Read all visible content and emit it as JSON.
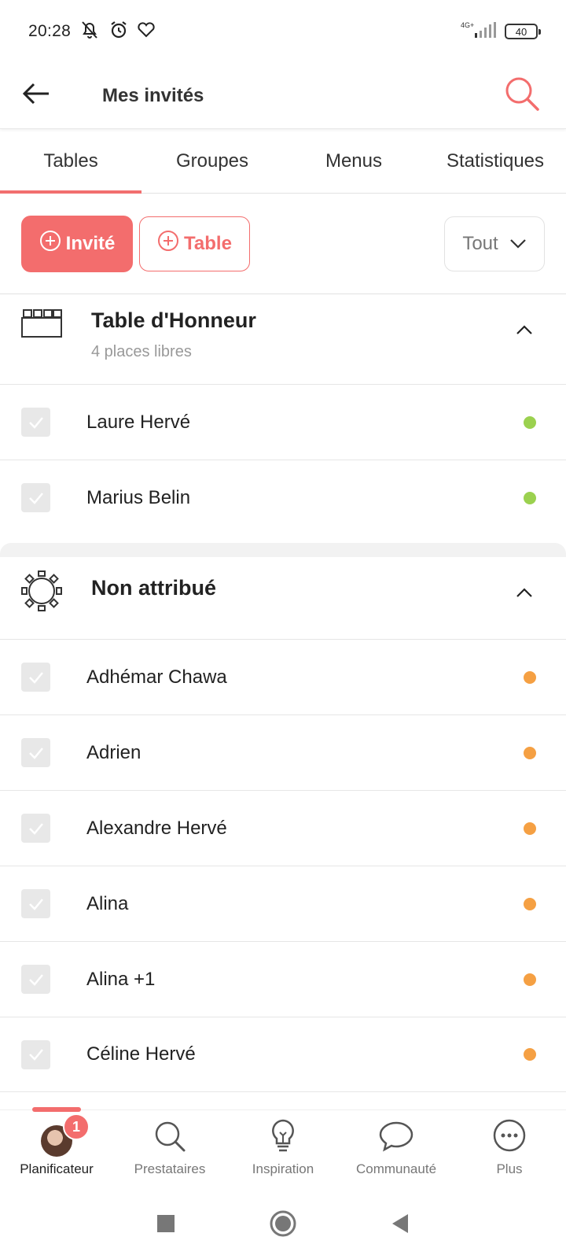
{
  "status_bar": {
    "time": "20:28",
    "network": "4G+",
    "battery": "40"
  },
  "header": {
    "title": "Mes invités"
  },
  "tabs": [
    {
      "label": "Tables",
      "active": true
    },
    {
      "label": "Groupes",
      "active": false
    },
    {
      "label": "Menus",
      "active": false
    },
    {
      "label": "Statistiques",
      "active": false
    }
  ],
  "actions": {
    "add_guest_label": "Invité",
    "add_table_label": "Table",
    "filter_label": "Tout"
  },
  "sections": [
    {
      "title": "Table d'Honneur",
      "subtitle": "4 places libres",
      "icon": "rectangular-table-icon",
      "guests": [
        {
          "name": "Laure Hervé",
          "status_color": "#9bd14f"
        },
        {
          "name": "Marius Belin",
          "status_color": "#9bd14f"
        }
      ]
    },
    {
      "title": "Non attribué",
      "icon": "round-table-icon",
      "guests": [
        {
          "name": "Adhémar Chawa",
          "status_color": "#f5a043"
        },
        {
          "name": "Adrien",
          "status_color": "#f5a043"
        },
        {
          "name": "Alexandre Hervé",
          "status_color": "#f5a043"
        },
        {
          "name": "Alina",
          "status_color": "#f5a043"
        },
        {
          "name": "Alina +1",
          "status_color": "#f5a043"
        },
        {
          "name": "Céline Hervé",
          "status_color": "#f5a043"
        }
      ]
    }
  ],
  "bottom_nav": {
    "items": [
      {
        "label": "Planificateur",
        "icon": "avatar",
        "active": true
      },
      {
        "label": "Prestataires",
        "icon": "search-icon",
        "active": false
      },
      {
        "label": "Inspiration",
        "icon": "lightbulb-icon",
        "active": false
      },
      {
        "label": "Communauté",
        "icon": "chat-bubble-icon",
        "active": false
      },
      {
        "label": "Plus",
        "icon": "more-icon",
        "active": false
      }
    ],
    "badge_count": "1"
  },
  "colors": {
    "accent": "#f36d6d",
    "confirmed": "#9bd14f",
    "pending": "#f5a043"
  }
}
